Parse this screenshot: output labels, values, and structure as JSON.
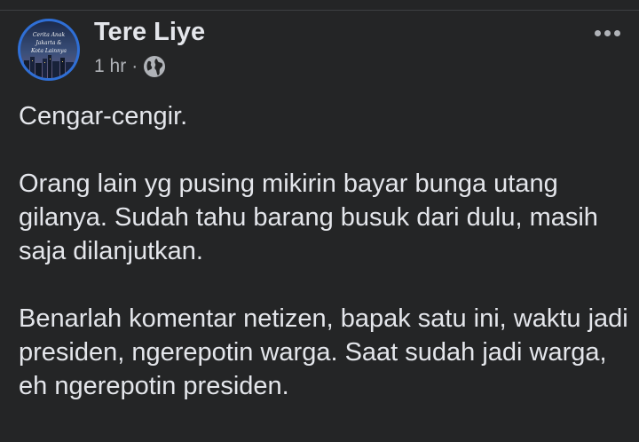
{
  "post": {
    "author": "Tere Liye",
    "timestamp": "1 hr",
    "separator": "·",
    "privacy_icon": "globe-icon",
    "more_icon": "more-horizontal-icon",
    "avatar_text": "Cerita Anak Jakarta & Kota Lainnya",
    "paragraphs": [
      "Cengar-cengir.",
      "Orang lain yg pusing mikirin bayar bunga utang gilanya. Sudah tahu barang busuk dari dulu, masih saja dilanjutkan.",
      "Benarlah komentar netizen, bapak satu ini, waktu jadi presiden, ngerepotin warga. Saat sudah jadi warga, eh ngerepotin presiden."
    ]
  },
  "colors": {
    "background": "#242526",
    "text_primary": "#e4e6eb",
    "text_secondary": "#b0b3b8",
    "avatar_ring": "#2f6fd6"
  }
}
